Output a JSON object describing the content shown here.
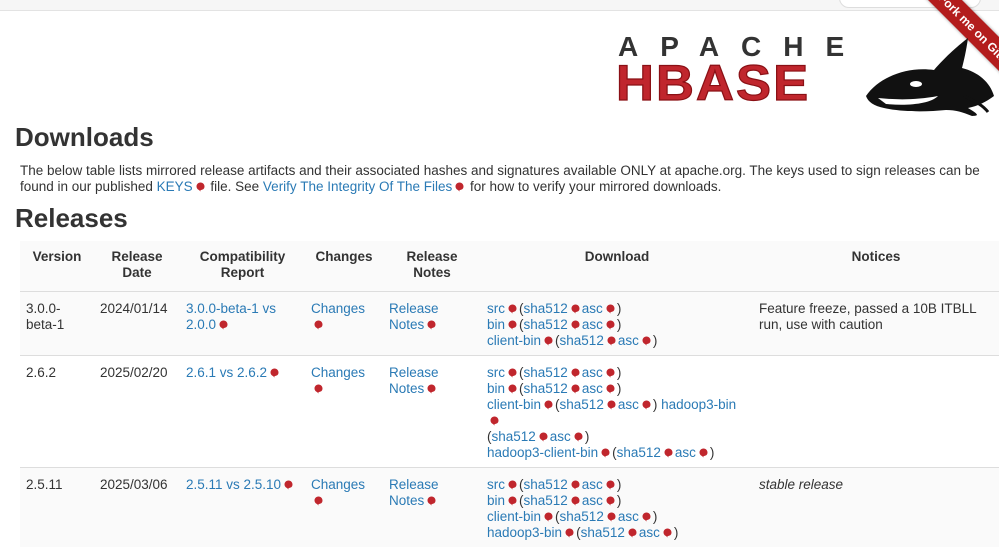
{
  "ribbon": {
    "label": "Fork me on GitHub"
  },
  "logo": {
    "top_text": "APACHE",
    "main_text": "HBASE"
  },
  "page": {
    "title": "Downloads",
    "intro": {
      "part1": "The below table lists mirrored release artifacts and their associated hashes and signatures available ONLY at apache.org. The keys used to sign releases can be found in our published ",
      "keys_link": "KEYS",
      "part2": " file. See ",
      "verify_link": "Verify The Integrity Of The Files",
      "part3": " for how to verify your mirrored downloads."
    },
    "releases_heading": "Releases"
  },
  "table": {
    "headers": [
      "Version",
      "Release Date",
      "Compatibility Report",
      "Changes",
      "Release Notes",
      "Download",
      "Notices"
    ],
    "rows": [
      {
        "version": "3.0.0-beta-1",
        "date": "2024/01/14",
        "compat": "3.0.0-beta-1 vs 2.0.0",
        "changes": "Changes",
        "notes": "Release Notes",
        "notice": "Feature freeze, passed a 10B ITBLL run, use with caution"
      },
      {
        "version": "2.6.2",
        "date": "2025/02/20",
        "compat": "2.6.1 vs 2.6.2",
        "changes": "Changes",
        "notes": "Release Notes",
        "notice": ""
      },
      {
        "version": "2.5.11",
        "date": "2025/03/06",
        "compat": "2.5.11 vs 2.5.10",
        "changes": "Changes",
        "notes": "Release Notes",
        "notice": "stable release"
      }
    ],
    "download_labels": {
      "src": "src",
      "bin": "bin",
      "client_bin": "client-bin",
      "hadoop3_bin": "hadoop3-bin",
      "hadoop3_client_bin": "hadoop3-client-bin",
      "sha512": "sha512",
      "asc": "asc"
    }
  },
  "colors": {
    "link": "#2a7ab5",
    "brand_red": "#c0262d",
    "ribbon": "#b31d1d"
  }
}
